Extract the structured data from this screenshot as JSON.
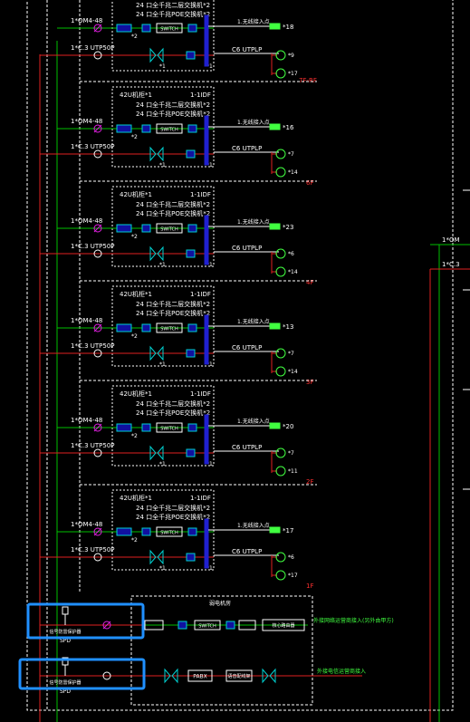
{
  "colors": {
    "background": "#000000",
    "frame": "#ffffff",
    "fiber_line": "#00c000",
    "copper_line": "#e02020",
    "bus_bar": "#2020d0",
    "module_fill": "#1010a0",
    "patch_panel": "#00d0d0",
    "fiber_cable_marker": "#e020e0",
    "floor_label": "#ff3030",
    "outlet_green": "#40ff40",
    "highlight_box": "#2090ff",
    "external_text": "#40ff40"
  },
  "floors": [
    {
      "cabinet_title": "",
      "cabinet_id": "",
      "switch_line_1": "24 口全千兆二层交换机*2",
      "switch_line_2": "24 口全千兆POE交换机*2",
      "fiber_cable": "1*OM4-48",
      "copper_cable": "1*C.3 UTP50P",
      "module_count_top": "*2",
      "module_count_bottom": "*1",
      "switch_label": "SWITCH",
      "patch_label": "*1",
      "ap_text": "1.无线接入点",
      "ap_count": "*18",
      "copper_outlet_label": "C6 UTPLP",
      "outlet_a_count": "*9",
      "outlet_b_count": "*17",
      "floor_label": "7F-RF"
    },
    {
      "cabinet_title": "42U机柜*1",
      "cabinet_id": "1-1IDF",
      "switch_line_1": "24 口全千兆二层交换机*2",
      "switch_line_2": "24 口全千兆POE交换机*2",
      "fiber_cable": "1*OM4-48",
      "copper_cable": "1*C.3 UTP50P",
      "module_count_top": "*2",
      "module_count_bottom": "*1",
      "switch_label": "SWITCH",
      "patch_label": "*1",
      "ap_text": "1.无线接入点",
      "ap_count": "*16",
      "copper_outlet_label": "C6 UTPLP",
      "outlet_a_count": "*7",
      "outlet_b_count": "*14",
      "floor_label": "6F"
    },
    {
      "cabinet_title": "42U机柜*1",
      "cabinet_id": "1-1IDF",
      "switch_line_1": "24 口全千兆二层交换机*2",
      "switch_line_2": "24 口全千兆POE交换机*2",
      "fiber_cable": "1*OM4-48",
      "copper_cable": "1*C.3 UTP50P",
      "module_count_top": "*2",
      "module_count_bottom": "*1",
      "switch_label": "SWITCH",
      "patch_label": "*1",
      "ap_text": "1.无线接入点",
      "ap_count": "*23",
      "copper_outlet_label": "C6 UTPLP",
      "outlet_a_count": "*6",
      "outlet_b_count": "*14",
      "floor_label": "4F"
    },
    {
      "cabinet_title": "42U机柜*1",
      "cabinet_id": "1-1IDF",
      "switch_line_1": "24 口全千兆二层交换机*2",
      "switch_line_2": "24 口全千兆POE交换机*2",
      "fiber_cable": "1*OM4-48",
      "copper_cable": "1*C.3 UTP50P",
      "module_count_top": "*2",
      "module_count_bottom": "*1",
      "switch_label": "SWITCH",
      "patch_label": "*1",
      "ap_text": "1.无线接入点",
      "ap_count": "*13",
      "copper_outlet_label": "C6 UTPLP",
      "outlet_a_count": "*7",
      "outlet_b_count": "*14",
      "floor_label": "3F"
    },
    {
      "cabinet_title": "42U机柜*1",
      "cabinet_id": "1-1IDF",
      "switch_line_1": "24 口全千兆二层交换机*2",
      "switch_line_2": "24 口全千兆POE交换机*2",
      "fiber_cable": "1*OM4-48",
      "copper_cable": "1*C.3 UTP50P",
      "module_count_top": "*2",
      "module_count_bottom": "*1",
      "switch_label": "SWITCH",
      "patch_label": "*1",
      "ap_text": "1.无线接入点",
      "ap_count": "*20",
      "copper_outlet_label": "C6 UTPLP",
      "outlet_a_count": "*7",
      "outlet_b_count": "*11",
      "floor_label": "2F"
    },
    {
      "cabinet_title": "42U机柜*1",
      "cabinet_id": "1-1IDF",
      "switch_line_1": "24 口全千兆二层交换机*2",
      "switch_line_2": "24 口全千兆POE交换机*2",
      "fiber_cable": "1*OM4-48",
      "copper_cable": "1*C.3 UTP50P",
      "module_count_top": "*2",
      "module_count_bottom": "*1",
      "switch_label": "SWITCH",
      "patch_label": "*1",
      "ap_text": "1.无线接入点",
      "ap_count": "*17",
      "copper_outlet_label": "C6 UTPLP",
      "outlet_a_count": "*6",
      "outlet_b_count": "*17",
      "floor_label": "1F"
    }
  ],
  "ground": {
    "room_title": "弱电机房",
    "spd_label_1": "SPD",
    "spd_caption_1": "信号防雷保护器",
    "spd_label_2": "SPD",
    "spd_caption_2": "信号防雷保护器",
    "switch_label": "SWITCH",
    "router_label": "核心路由器",
    "pabx_label": "PABX",
    "voice_label": "语音配线架",
    "external_data_text": "外接网络运营商接入(另外由甲方)",
    "external_voice_text": "外接电信运营商接入"
  },
  "right_side": {
    "label_1": "1*OM",
    "label_2": "1*C.3"
  }
}
